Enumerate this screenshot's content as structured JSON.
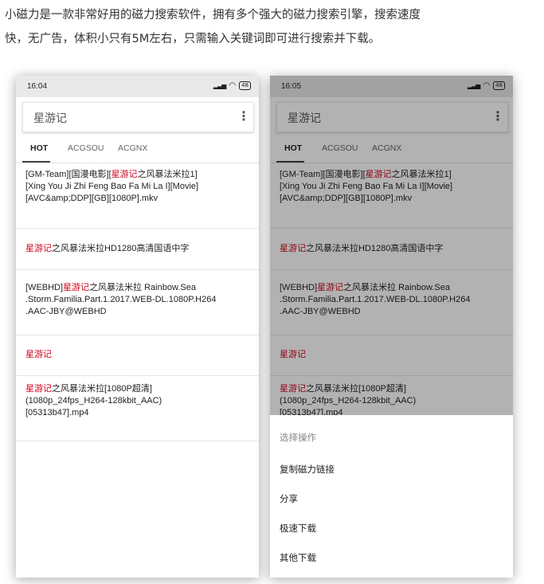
{
  "intro": {
    "line1": "小磁力是一款非常好用的磁力搜索软件，拥有多个强大的磁力搜索引擎，搜索速度",
    "line2": "快，无广告，体积小只有5M左右，只需输入关键词即可进行搜索并下载。"
  },
  "phones": {
    "left": {
      "time": "16:04",
      "battery": "48",
      "query": "星游记",
      "tabs": [
        "HOT",
        "ACGSOU",
        "ACGNX"
      ],
      "items": [
        {
          "pre": "[GM-Team][国漫电影][",
          "hl": "星游记",
          "post": "之风暴法米拉1]",
          "l2": "[Xing You Ji Zhi Feng Bao Fa Mi La I][Movie]",
          "l3": "[AVC&amp;DDP][GB][1080P].mkv"
        },
        {
          "pre": "",
          "hl": "星游记",
          "post": "之风暴法米拉HD1280高清国语中字"
        },
        {
          "pre": "[WEBHD]",
          "hl": "星游记",
          "post": "之风暴法米拉 Rainbow.Sea",
          "l2": ".Storm.Familia.Part.1.2017.WEB-DL.1080P.H264",
          "l3": ".AAC-JBY@WEBHD"
        },
        {
          "pre": "",
          "hl": "星游记",
          "post": ""
        },
        {
          "pre": "",
          "hl": "星游记",
          "post": "之风暴法米拉[1080P超清]",
          "l2": "(1080p_24fps_H264-128kbit_AAC)",
          "l3": "[05313b47].mp4"
        }
      ]
    },
    "right": {
      "time": "16:05",
      "battery": "48",
      "query": "星游记",
      "tabs": [
        "HOT",
        "ACGSOU",
        "ACGNX"
      ],
      "items": [
        {
          "pre": "[GM-Team][国漫电影][",
          "hl": "星游记",
          "post": "之风暴法米拉1]",
          "l2": "[Xing You Ji Zhi Feng Bao Fa Mi La I][Movie]",
          "l3": "[AVC&amp;DDP][GB][1080P].mkv"
        },
        {
          "pre": "",
          "hl": "星游记",
          "post": "之风暴法米拉HD1280高清国语中字"
        },
        {
          "pre": "[WEBHD]",
          "hl": "星游记",
          "post": "之风暴法米拉 Rainbow.Sea",
          "l2": ".Storm.Familia.Part.1.2017.WEB-DL.1080P.H264",
          "l3": ".AAC-JBY@WEBHD"
        },
        {
          "pre": "",
          "hl": "星游记",
          "post": ""
        },
        {
          "pre": "",
          "hl": "星游记",
          "post": "之风暴法米拉[1080P超清]",
          "l2": "(1080p_24fps_H264-128kbit_AAC)",
          "l3": "[05313b47].mp4"
        }
      ],
      "sheet": {
        "title": "选择操作",
        "options": [
          "复制磁力链接",
          "分享",
          "极速下载",
          "其他下载"
        ]
      }
    }
  },
  "colors": {
    "highlight": "#d0021b",
    "statusbar": "#e9e9e9"
  },
  "icons": [
    "signal-icon",
    "wifi-icon",
    "battery-icon",
    "more-vert-icon"
  ]
}
